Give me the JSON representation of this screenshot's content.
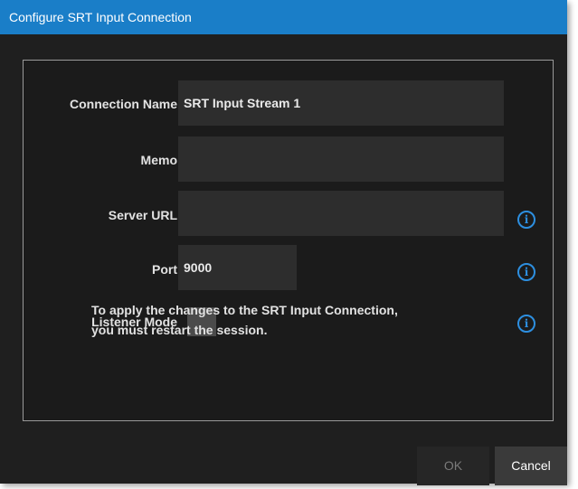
{
  "dialog": {
    "title": "Configure SRT Input Connection",
    "accent_color": "#1a7ec8"
  },
  "form": {
    "connection_name": {
      "label": "Connection Name",
      "value": "SRT Input Stream 1"
    },
    "memo": {
      "label": "Memo",
      "value": ""
    },
    "server_url": {
      "label": "Server URL",
      "value": "",
      "info_icon": "info-icon"
    },
    "port": {
      "label": "Port",
      "value": "9000",
      "info_icon": "info-icon"
    },
    "listener_mode": {
      "label": "Listener Mode",
      "checked": false,
      "info_icon": "info-icon"
    },
    "note_line1": "To apply the changes to the SRT Input Connection,",
    "note_line2": "you must restart the session."
  },
  "buttons": {
    "ok_label": "OK",
    "cancel_label": "Cancel"
  }
}
